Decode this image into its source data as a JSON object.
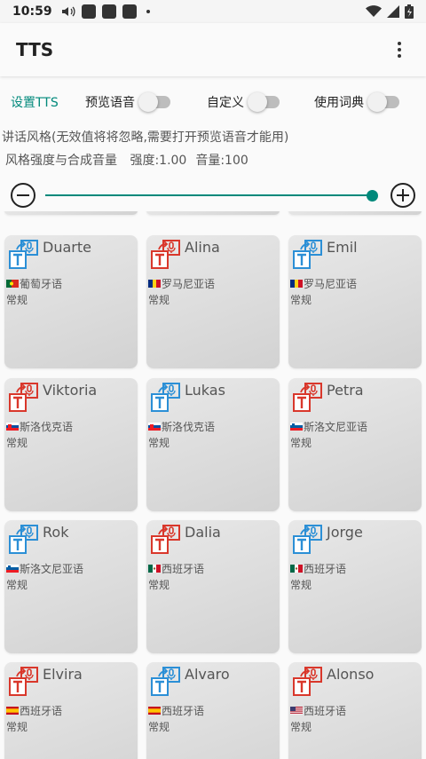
{
  "status": {
    "time": "10:59"
  },
  "app": {
    "title": "TTS"
  },
  "toolbar": {
    "settings_tab": "设置TTS",
    "preview_label": "预览语音",
    "custom_label": "自定义",
    "dictionary_label": "使用词典"
  },
  "info": {
    "speaking_style": "讲话风格(无效值将将忽略,需要打开预览语音才能用)",
    "strength_title": "风格强度与合成音量",
    "strength_value": "强度:1.00",
    "volume_value": "音量:100"
  },
  "slider": {
    "level": 1.0
  },
  "voices": [
    {
      "name": "Duarte",
      "language": "葡萄牙语",
      "style": "常规",
      "icon": "blue",
      "flag": "portugal"
    },
    {
      "name": "Alina",
      "language": "罗马尼亚语",
      "style": "常规",
      "icon": "red",
      "flag": "romania"
    },
    {
      "name": "Emil",
      "language": "罗马尼亚语",
      "style": "常规",
      "icon": "blue",
      "flag": "romania"
    },
    {
      "name": "Viktoria",
      "language": "斯洛伐克语",
      "style": "常规",
      "icon": "red",
      "flag": "slovakia"
    },
    {
      "name": "Lukas",
      "language": "斯洛伐克语",
      "style": "常规",
      "icon": "blue",
      "flag": "slovakia"
    },
    {
      "name": "Petra",
      "language": "斯洛文尼亚语",
      "style": "常规",
      "icon": "red",
      "flag": "slovenia"
    },
    {
      "name": "Rok",
      "language": "斯洛文尼亚语",
      "style": "常规",
      "icon": "blue",
      "flag": "slovenia"
    },
    {
      "name": "Dalia",
      "language": "西班牙语",
      "style": "常规",
      "icon": "red",
      "flag": "mexico"
    },
    {
      "name": "Jorge",
      "language": "西班牙语",
      "style": "常规",
      "icon": "blue",
      "flag": "mexico"
    },
    {
      "name": "Elvira",
      "language": "西班牙语",
      "style": "常规",
      "icon": "red",
      "flag": "spain"
    },
    {
      "name": "Alvaro",
      "language": "西班牙语",
      "style": "常规",
      "icon": "blue",
      "flag": "spain"
    },
    {
      "name": "Alonso",
      "language": "西班牙语",
      "style": "常规",
      "icon": "red",
      "flag": "usa"
    }
  ],
  "colors": {
    "accent": "#00897b",
    "icon_blue": "#2b8fd6",
    "icon_red": "#d9372b"
  }
}
